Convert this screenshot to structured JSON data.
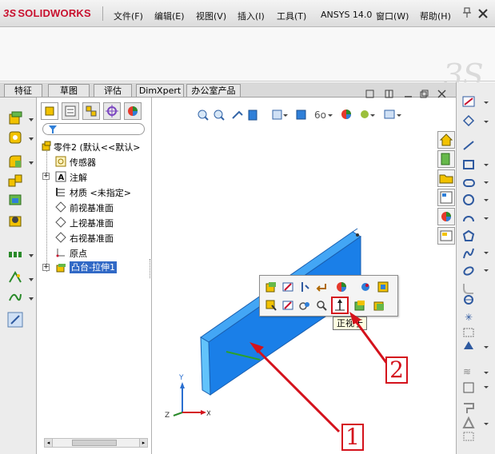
{
  "app": {
    "logo_prefix": "3S",
    "logo_text": "SOLIDWORKS",
    "brand_color": "#c8102e"
  },
  "menu": [
    {
      "label": "文件(F)"
    },
    {
      "label": "编辑(E)"
    },
    {
      "label": "视图(V)"
    },
    {
      "label": "插入(I)"
    },
    {
      "label": "工具(T)"
    },
    {
      "label": "ANSYS 14.0"
    },
    {
      "label": "窗口(W)"
    },
    {
      "label": "帮助(H)"
    }
  ],
  "tabs": [
    {
      "label": "特征"
    },
    {
      "label": "草图"
    },
    {
      "label": "评估"
    },
    {
      "label": "DimXpert"
    },
    {
      "label": "办公室产品"
    }
  ],
  "feature_tree": {
    "root": "零件2 (默认<<默认>",
    "items": [
      {
        "label": "传感器",
        "icon": "sensor-icon"
      },
      {
        "label": "注解",
        "icon": "annotation-icon"
      },
      {
        "label": "材质 <未指定>",
        "icon": "material-icon"
      },
      {
        "label": "前视基准面",
        "icon": "plane-icon"
      },
      {
        "label": "上视基准面",
        "icon": "plane-icon"
      },
      {
        "label": "右视基准面",
        "icon": "plane-icon"
      },
      {
        "label": "原点",
        "icon": "origin-icon"
      },
      {
        "label": "凸台-拉伸1",
        "icon": "boss-extrude-icon",
        "selected": true
      }
    ]
  },
  "context_toolbar": {
    "tooltip": "正视于"
  },
  "callouts": [
    {
      "label": "1"
    },
    {
      "label": "2"
    }
  ],
  "triad": {
    "x": "X",
    "y": "Y",
    "z": "Z"
  },
  "colors": {
    "part_blue": "#1a7fe8",
    "arrow_red": "#d4121c",
    "selection_blue": "#3169c6"
  }
}
